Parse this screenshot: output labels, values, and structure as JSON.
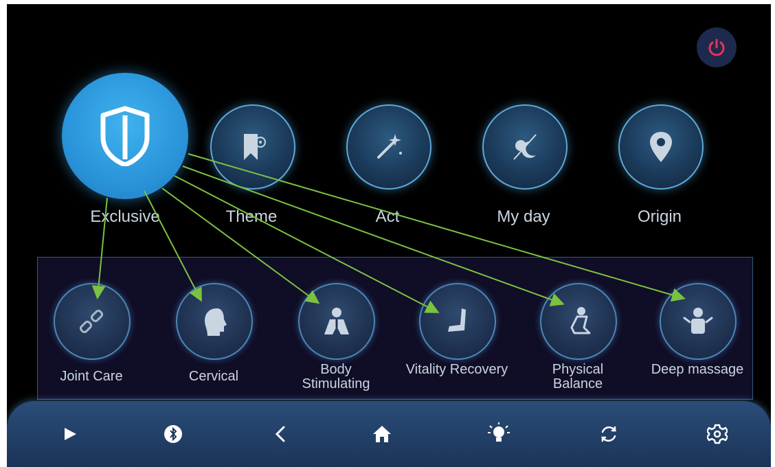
{
  "categories": [
    {
      "label": "Exclusive",
      "icon": "shield-icon",
      "active": true
    },
    {
      "label": "Theme",
      "icon": "bookmark-icon",
      "active": false
    },
    {
      "label": "Act",
      "icon": "magic-wand-icon",
      "active": false
    },
    {
      "label": "My day",
      "icon": "day-night-icon",
      "active": false
    },
    {
      "label": "Origin",
      "icon": "location-pin-icon",
      "active": false
    }
  ],
  "programs": [
    {
      "label": "Joint Care",
      "icon": "joint-icon"
    },
    {
      "label": "Cervical",
      "icon": "head-neck-icon"
    },
    {
      "label": "Body Stimulating",
      "icon": "body-icon"
    },
    {
      "label": "Vitality Recovery",
      "icon": "seat-icon"
    },
    {
      "label": "Physical Balance",
      "icon": "balance-icon"
    },
    {
      "label": "Deep massage",
      "icon": "person-icon"
    }
  ],
  "nav": [
    "play-icon",
    "bluetooth-icon",
    "back-icon",
    "home-icon",
    "light-icon",
    "sync-icon",
    "settings-icon"
  ],
  "colors": {
    "accent": "#3fb2ee",
    "power": "#e8345a",
    "arrow": "#7cc242",
    "text": "#c9d6e2"
  }
}
